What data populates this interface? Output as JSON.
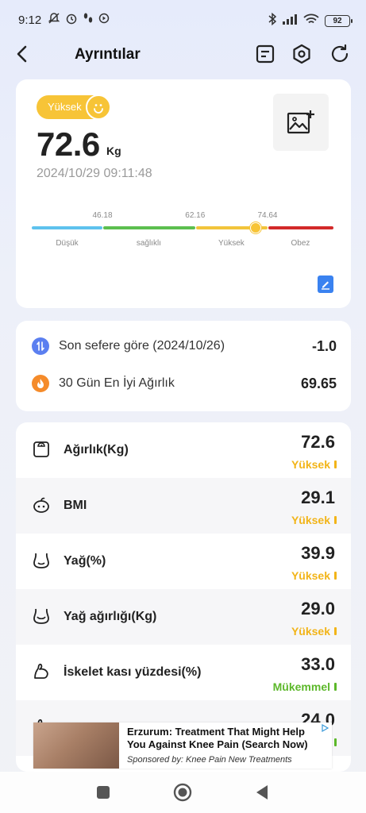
{
  "status_bar": {
    "time": "9:12",
    "battery": "92"
  },
  "header": {
    "title": "Ayrıntılar"
  },
  "weight_card": {
    "status": "Yüksek",
    "weight": "72.6",
    "unit": "Kg",
    "datetime": "2024/10/29 09:11:48",
    "scale": {
      "ticks": [
        "46.18",
        "62.16",
        "74.64"
      ],
      "labels": [
        "Düşük",
        "sağlıklı",
        "Yüksek",
        "Obez"
      ],
      "colors": [
        "#5ec2ee",
        "#5cbf4f",
        "#f2c43b",
        "#d32a2a"
      ],
      "min": 34,
      "max": 86,
      "marker_value": 72.6
    }
  },
  "comparison": [
    {
      "label": "Son sefere göre (2024/10/26)",
      "value": "-1.0",
      "icon": "compare-icon",
      "color": "#5b7ff0"
    },
    {
      "label": "30 Gün En İyi Ağırlık",
      "value": "69.65",
      "icon": "flame-icon",
      "color": "#f58b2a"
    }
  ],
  "metrics": [
    {
      "name": "Ağırlık(Kg)",
      "value": "72.6",
      "status": "Yüksek",
      "color": "#f2b418",
      "icon": "scale-icon"
    },
    {
      "name": "BMI",
      "value": "29.1",
      "status": "Yüksek",
      "color": "#f2b418",
      "icon": "bmi-icon"
    },
    {
      "name": "Yağ(%)",
      "value": "39.9",
      "status": "Yüksek",
      "color": "#f2b418",
      "icon": "body-fat-icon"
    },
    {
      "name": "Yağ ağırlığı(Kg)",
      "value": "29.0",
      "status": "Yüksek",
      "color": "#f2b418",
      "icon": "fat-weight-icon"
    },
    {
      "name": "İskelet kası yüzdesi(%)",
      "value": "33.0",
      "status": "Mükemmel",
      "color": "#5cb82a",
      "icon": "muscle-icon"
    },
    {
      "name": "",
      "value": "24.0",
      "status": "",
      "color": "#5cb82a",
      "icon": "muscle-weight-icon"
    }
  ],
  "ad": {
    "title": "Erzurum: Treatment That Might Help You Against Knee Pain (Search Now)",
    "sponsor": "Sponsored by: Knee Pain New Treatments"
  }
}
